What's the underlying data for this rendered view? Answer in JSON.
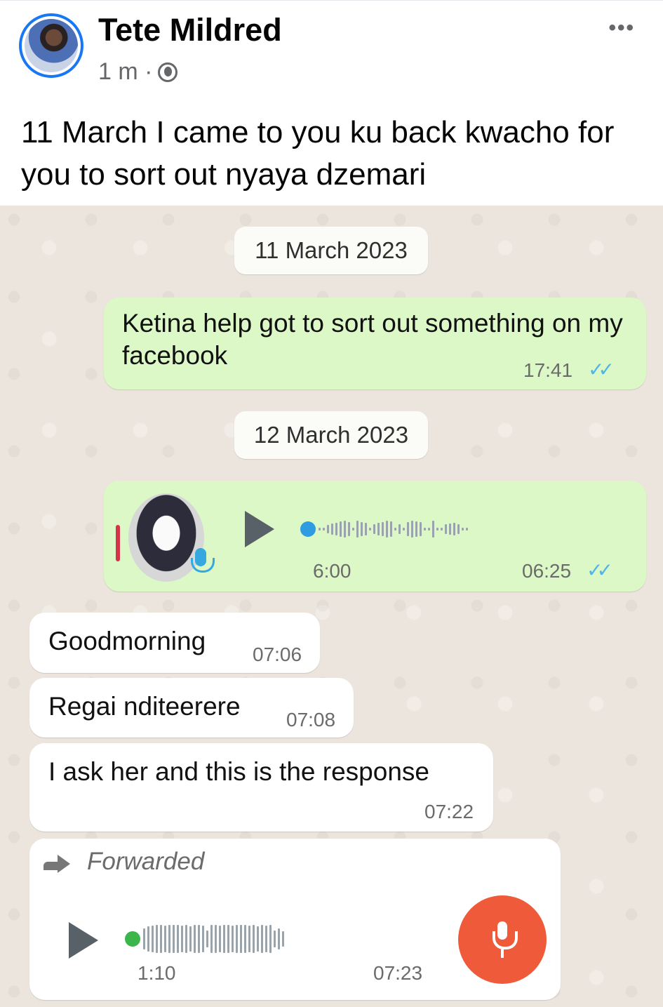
{
  "post": {
    "author": "Tete Mildred",
    "time": "1 m ·",
    "text": "11 March I came to you ku back kwacho for you to sort out nyaya dzemari",
    "more": "•••"
  },
  "chat": {
    "dates": [
      "11 March 2023",
      "12 March 2023"
    ],
    "messages": [
      {
        "direction": "out",
        "text": "Ketina help got to sort out something on my facebook",
        "time": "17:41",
        "ticks": "✓✓"
      },
      {
        "direction": "out",
        "type": "voice",
        "duration": "6:00",
        "time": "06:25",
        "ticks": "✓✓",
        "progress": 0
      },
      {
        "direction": "in",
        "text": "Goodmorning",
        "time": "07:06"
      },
      {
        "direction": "in",
        "text": "Regai nditeerere",
        "time": "07:08"
      },
      {
        "direction": "in",
        "text": "I ask her and this is the response",
        "time": "07:22"
      },
      {
        "direction": "in",
        "type": "voice",
        "forwarded_label": "Forwarded",
        "duration": "1:10",
        "time": "07:23",
        "progress": 0
      }
    ]
  },
  "colors": {
    "outgoing": "#dcf8c6",
    "incoming": "#ffffff",
    "chat_background": "#ece5dd",
    "tick_blue": "#4fb6ec",
    "progress_blue": "#2f9be0",
    "progress_green": "#3cb54a",
    "record_orange": "#ef5b3a"
  },
  "icons": [
    "globe-icon",
    "more-icon",
    "double-tick-icon",
    "play-icon",
    "microphone-icon",
    "forward-icon"
  ]
}
